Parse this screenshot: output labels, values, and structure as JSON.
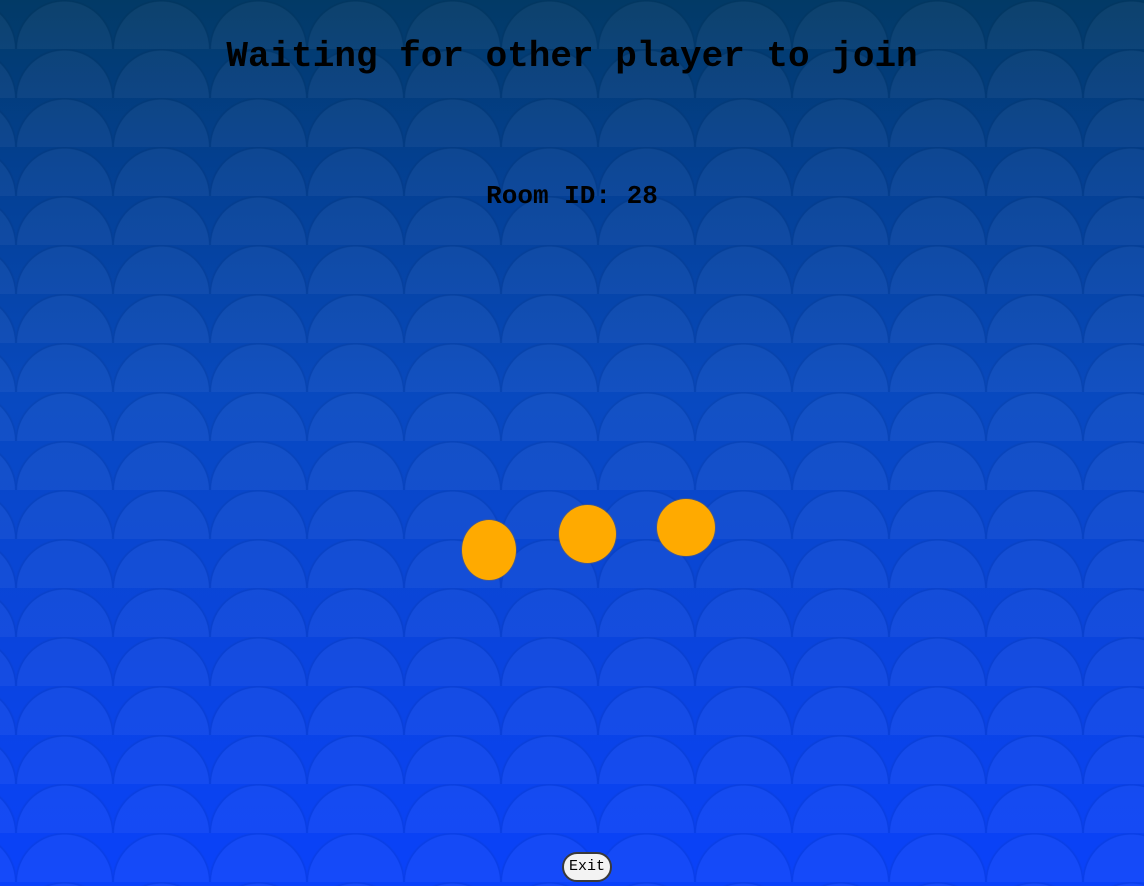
{
  "header": {
    "title": "Waiting for other player to join"
  },
  "room": {
    "label": "Room ID: 28"
  },
  "loader": {
    "dot_count": 3,
    "dot_color": "#ffaa00"
  },
  "footer": {
    "exit_label": "Exit"
  },
  "colors": {
    "background_top": "#023a66",
    "background_bottom": "#0a42fb",
    "text": "#000000"
  }
}
